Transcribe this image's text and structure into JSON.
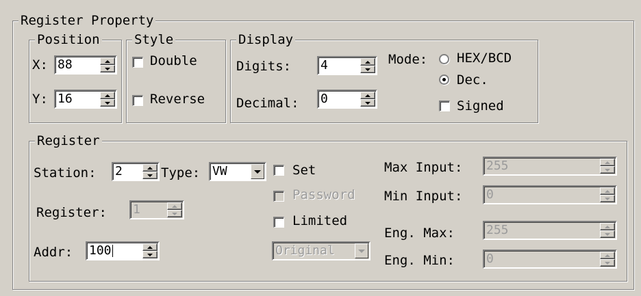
{
  "outer": {
    "title": "Register Property"
  },
  "position": {
    "title": "Position",
    "x_label": "X:",
    "x_value": "88",
    "y_label": "Y:",
    "y_value": "16"
  },
  "style": {
    "title": "Style",
    "double_label": "Double",
    "double_checked": false,
    "reverse_label": "Reverse",
    "reverse_checked": false
  },
  "display": {
    "title": "Display",
    "digits_label": "Digits:",
    "digits_value": "4",
    "decimal_label": "Decimal:",
    "decimal_value": "0",
    "mode_label": "Mode:",
    "mode_hex_label": "HEX/BCD",
    "mode_dec_label": "Dec.",
    "mode_selected": "Dec.",
    "signed_label": "Signed",
    "signed_checked": false
  },
  "register": {
    "title": "Register",
    "station_label": "Station:",
    "station_value": "2",
    "type_label": "Type:",
    "type_value": "VW",
    "register_label": "Register:",
    "register_value": "1",
    "addr_label": "Addr:",
    "addr_value": "100",
    "set_label": "Set",
    "set_checked": false,
    "password_label": "Password",
    "password_checked": false,
    "limited_label": "Limited",
    "limited_checked": false,
    "conversion_value": "Original",
    "max_input_label": "Max Input:",
    "max_input_value": "255",
    "min_input_label": "Min Input:",
    "min_input_value": "0",
    "eng_max_label": "Eng. Max:",
    "eng_max_value": "255",
    "eng_min_label": "Eng. Min:",
    "eng_min_value": "0"
  }
}
